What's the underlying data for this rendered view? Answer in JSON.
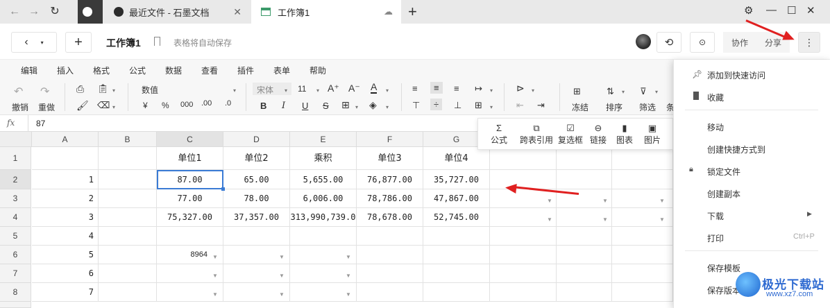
{
  "browser": {
    "tabs": [
      {
        "label": "最近文件 - 石墨文档"
      },
      {
        "label": "工作簿1"
      }
    ]
  },
  "doc": {
    "title": "工作簿1",
    "autosave": "表格将自动保存",
    "collab": "协作",
    "share": "分享"
  },
  "menu": [
    "编辑",
    "插入",
    "格式",
    "公式",
    "数据",
    "查看",
    "插件",
    "表单",
    "帮助"
  ],
  "toolbar": {
    "undo": "撤销",
    "redo": "重做",
    "number_format": "数值",
    "currency": "¥",
    "percent": "%",
    "thousands": "000",
    "dec_inc": ".00",
    "dec_dec": ".0",
    "font": "宋体",
    "size": "11",
    "bold": "B",
    "italic": "I",
    "underline": "U",
    "strike": "S",
    "freeze": "冻结",
    "sort": "排序",
    "filter": "筛选",
    "cond": "条"
  },
  "insert_popup": [
    {
      "icon": "Σ",
      "label": "公式"
    },
    {
      "icon": "⧉",
      "label": "跨表引用"
    },
    {
      "icon": "☑",
      "label": "复选框"
    },
    {
      "icon": "⊖",
      "label": "链接"
    },
    {
      "icon": "▮",
      "label": "图表"
    },
    {
      "icon": "▣",
      "label": "图片"
    }
  ],
  "formula_bar": {
    "fx": "fx",
    "value": "87"
  },
  "columns": [
    "A",
    "B",
    "C",
    "D",
    "E",
    "F",
    "G"
  ],
  "rows": [
    "1",
    "2",
    "3",
    "4",
    "5",
    "6",
    "7",
    "8"
  ],
  "cells": {
    "C1": "单位1",
    "D1": "单位2",
    "E1": "乘积",
    "F1": "单位3",
    "G1": "单位4",
    "A2": "1",
    "C2": "87.00",
    "D2": "65.00",
    "E2": "5,655.00",
    "F2": "76,877.00",
    "G2": "35,727.00",
    "A3": "2",
    "C3": "77.00",
    "D3": "78.00",
    "E3": "6,006.00",
    "F3": "78,786.00",
    "G3": "47,867.00",
    "A4": "3",
    "C4": "75,327.00",
    "D4": "37,357.00",
    "E4": "313,990,739.0",
    "F4": "78,678.00",
    "G4": "52,745.00",
    "A5": "4",
    "A6": "5",
    "C6": "8964",
    "A7": "6",
    "A8": "7"
  },
  "context_menu": [
    {
      "label": "添加到快速访问",
      "icon": "pin-icon"
    },
    {
      "label": "收藏",
      "icon": "bookmark-icon"
    },
    {
      "label": "移动"
    },
    {
      "label": "创建快捷方式到"
    },
    {
      "label": "锁定文件",
      "icon": "lock-icon"
    },
    {
      "label": "创建副本"
    },
    {
      "label": "下载",
      "submenu": true
    },
    {
      "label": "打印",
      "shortcut": "Ctrl+P"
    },
    {
      "label": "保存模板"
    },
    {
      "label": "保存版本"
    }
  ],
  "watermark": {
    "title": "极光下载站",
    "url": "www.xz7.com"
  },
  "colors": {
    "accent": "#3a7bd5",
    "annotation": "#e02020",
    "tab_bar": "#e9e9e9"
  }
}
